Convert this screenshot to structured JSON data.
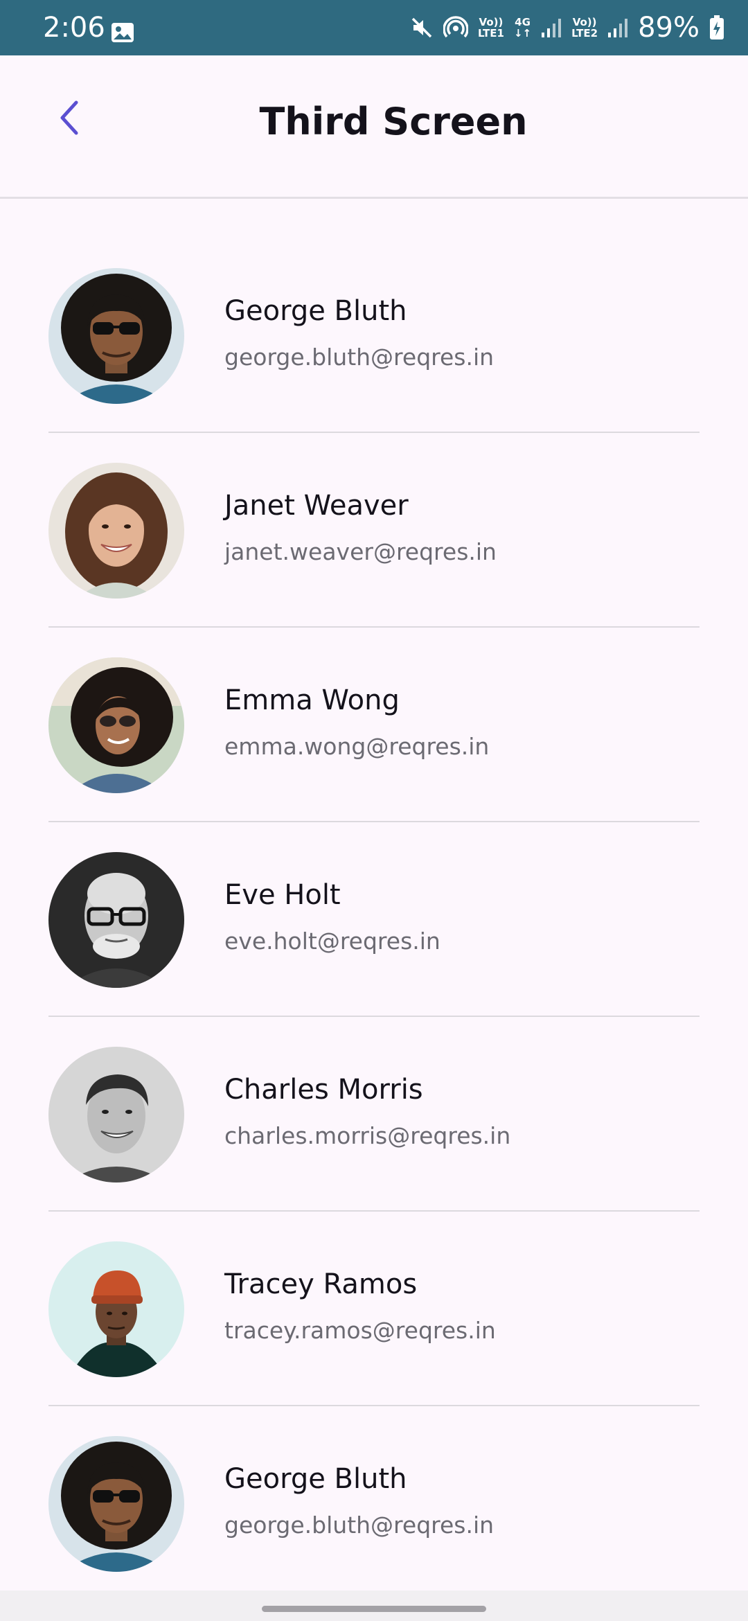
{
  "status_bar": {
    "time": "2:06",
    "sim1_top": "Vo))",
    "sim1_bottom": "LTE1",
    "net_type": "4G",
    "sim2_top": "Vo))",
    "sim2_bottom": "LTE2",
    "battery": "89%",
    "bar_color": "#2f6a80"
  },
  "app_bar": {
    "title": "Third Screen",
    "back_icon": "chevron-left-icon",
    "accent": "#5b4fd1"
  },
  "users": [
    {
      "name": "George Bluth",
      "email": "george.bluth@reqres.in"
    },
    {
      "name": "Janet Weaver",
      "email": "janet.weaver@reqres.in"
    },
    {
      "name": "Emma Wong",
      "email": "emma.wong@reqres.in"
    },
    {
      "name": "Eve Holt",
      "email": "eve.holt@reqres.in"
    },
    {
      "name": "Charles Morris",
      "email": "charles.morris@reqres.in"
    },
    {
      "name": "Tracey Ramos",
      "email": "tracey.ramos@reqres.in"
    },
    {
      "name": "George Bluth",
      "email": "george.bluth@reqres.in"
    }
  ]
}
